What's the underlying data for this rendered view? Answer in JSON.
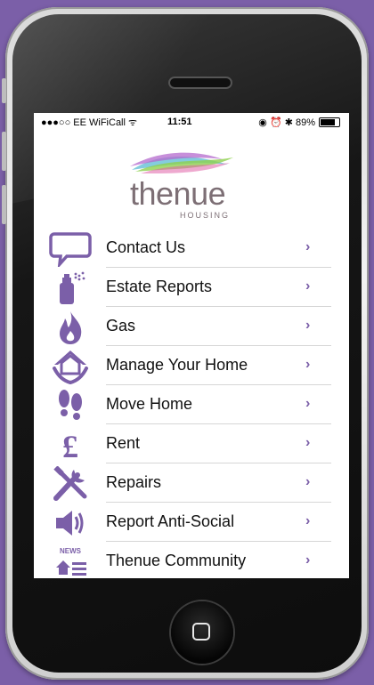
{
  "status_bar": {
    "carrier": "●●●○○ EE WiFiCall ᯤ",
    "time": "11:51",
    "right": "◉ ⏰ ✱ 89%",
    "battery_level": 0.89
  },
  "logo": {
    "name": "thenue",
    "subtitle": "HOUSING"
  },
  "menu": {
    "items": [
      {
        "label": "Contact Us",
        "icon": "speech-bubble-icon"
      },
      {
        "label": "Estate Reports",
        "icon": "spray-can-icon"
      },
      {
        "label": "Gas",
        "icon": "flame-icon"
      },
      {
        "label": "Manage Your Home",
        "icon": "house-hands-icon"
      },
      {
        "label": "Move Home",
        "icon": "footprints-icon"
      },
      {
        "label": "Rent",
        "icon": "pound-icon"
      },
      {
        "label": "Repairs",
        "icon": "tools-icon"
      },
      {
        "label": "Report Anti-Social",
        "icon": "speaker-icon"
      },
      {
        "label": "Thenue Community",
        "icon": "news-icon"
      }
    ],
    "chevron": "›",
    "news_badge": "NEWS"
  },
  "colors": {
    "accent": "#7b5fa8",
    "background": "#7b5fa8",
    "text": "#111111"
  }
}
